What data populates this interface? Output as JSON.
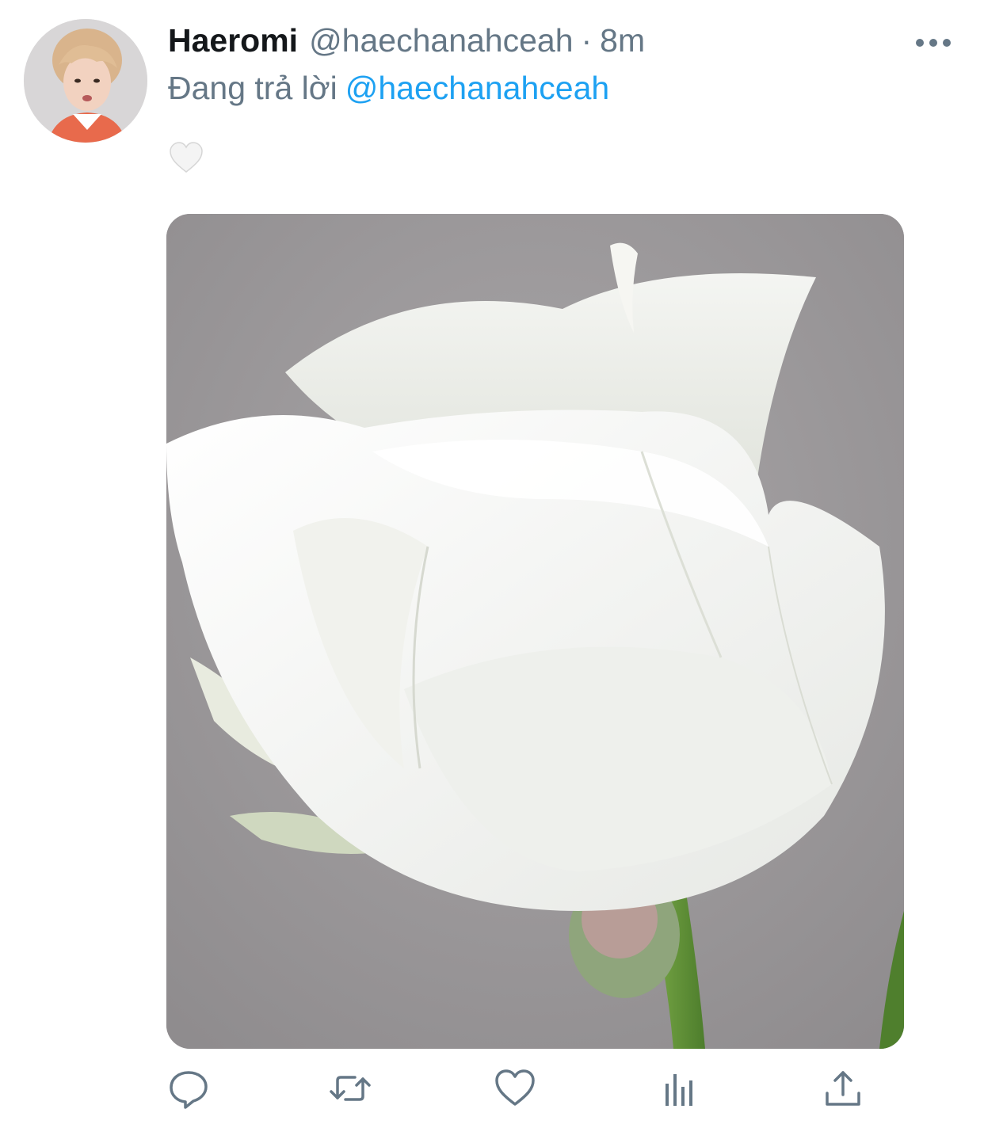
{
  "tweet": {
    "display_name": "Haeromi",
    "handle": "@haechanahceah",
    "separator": "·",
    "time": "8m",
    "reply_prefix": "Đang trả lời",
    "reply_to": "@haechanahceah",
    "text_emoji": "white-heart-emoji"
  },
  "icons": {
    "more": "more-icon",
    "reply": "reply-icon",
    "retweet": "retweet-icon",
    "like": "like-icon",
    "analytics": "analytics-icon",
    "share": "share-icon"
  },
  "colors": {
    "text_primary": "#14171a",
    "text_secondary": "#657786",
    "link": "#1da1f2"
  }
}
